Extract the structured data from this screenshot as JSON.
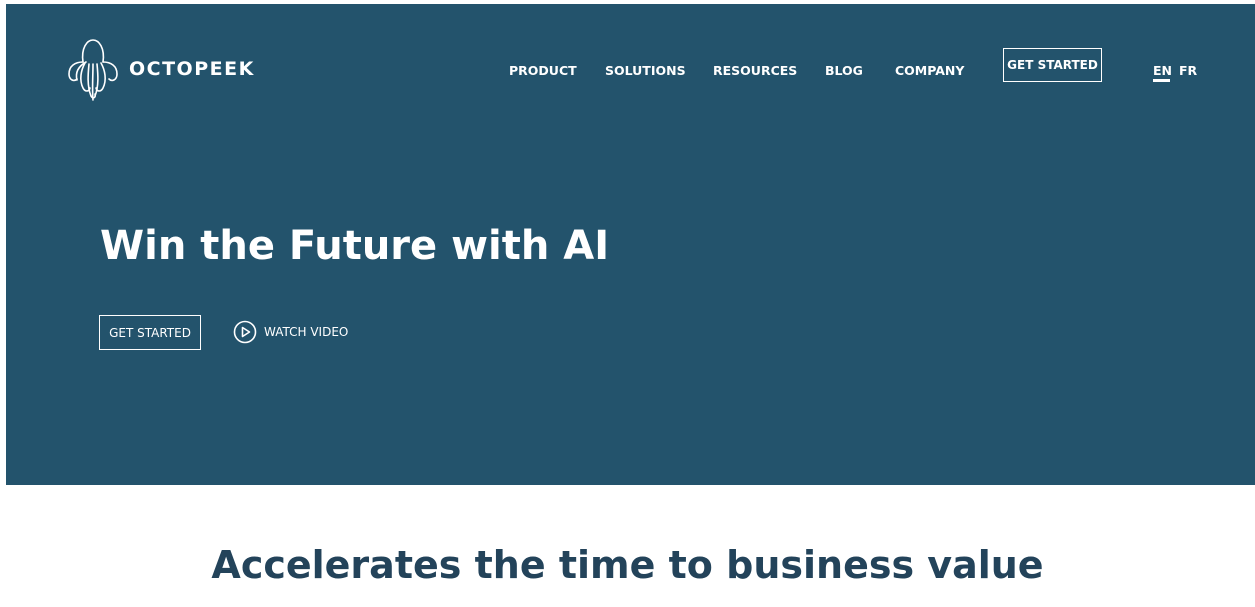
{
  "brand": {
    "name": "OCTOPEEK",
    "logo_icon": "octopus-icon"
  },
  "nav": {
    "items": [
      {
        "label": "PRODUCT"
      },
      {
        "label": "SOLUTIONS"
      },
      {
        "label": "RESOURCES"
      },
      {
        "label": "BLOG"
      },
      {
        "label": "COMPANY"
      }
    ],
    "cta_label": "GET STARTED",
    "languages": [
      {
        "label": "EN",
        "active": true
      },
      {
        "label": "FR",
        "active": false
      }
    ]
  },
  "hero": {
    "title": "Win the Future with AI",
    "cta_label": "GET STARTED",
    "watch_label": "WATCH VIDEO",
    "watch_icon": "play-circle-icon"
  },
  "section": {
    "title": "Accelerates the time to business value"
  },
  "colors": {
    "hero_background": "#23536c",
    "heading_text": "#23435a",
    "page_background": "#ffffff"
  }
}
